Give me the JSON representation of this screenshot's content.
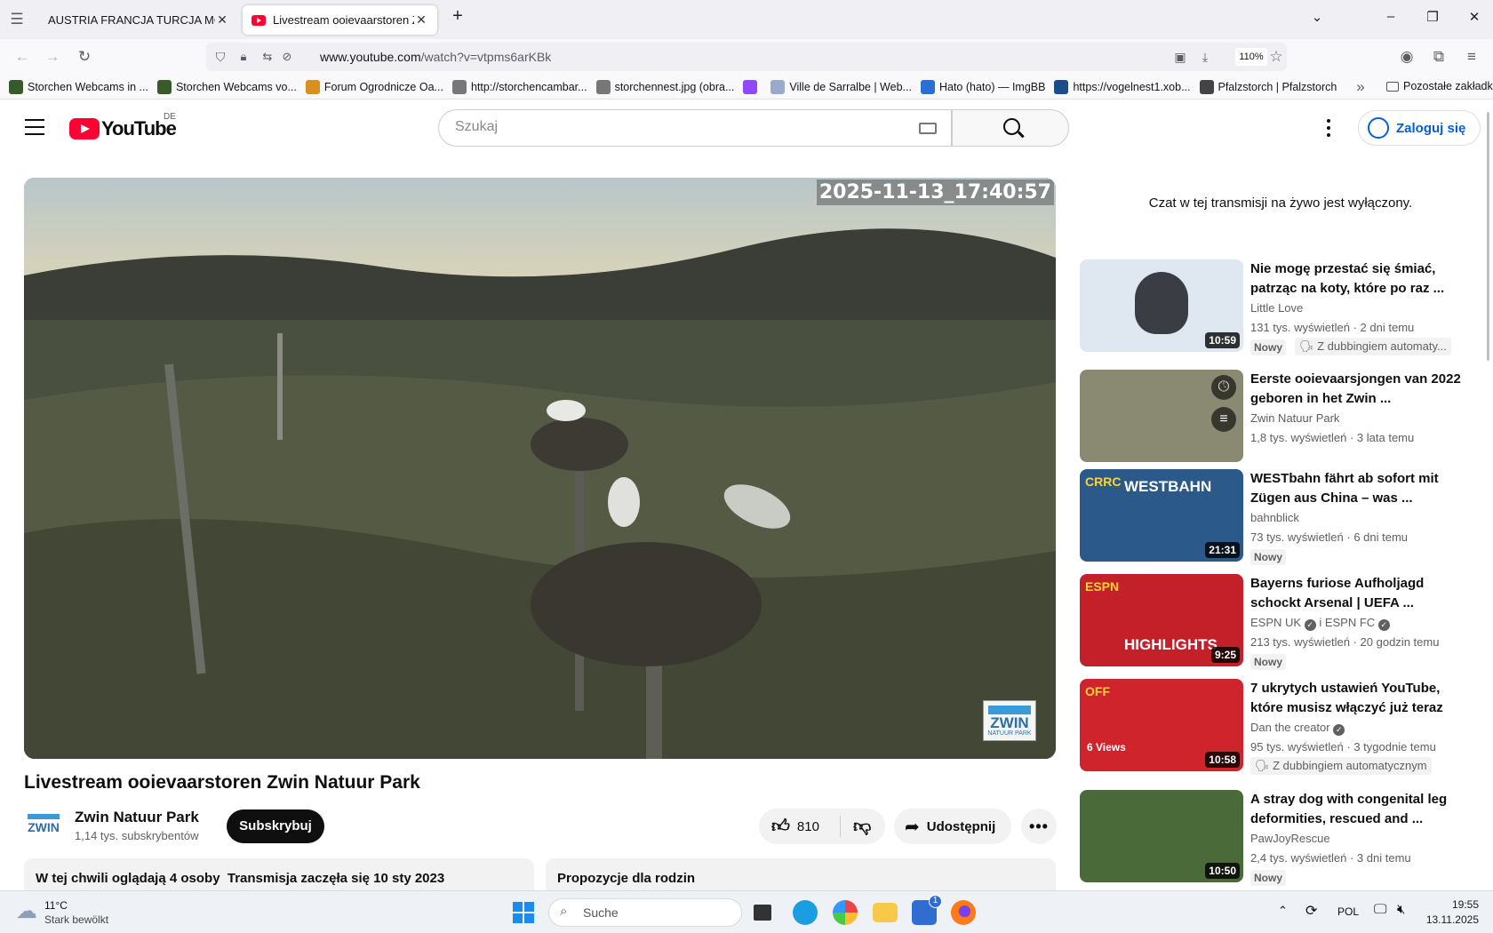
{
  "browser": {
    "tabs": [
      {
        "label": "AUSTRIA FRANCJA TURCJA MONTE",
        "active": false
      },
      {
        "label": "Livestream ooievaarstoren Zwin",
        "active": true
      }
    ],
    "new_tab": "+",
    "url_domain": "www.youtube.com",
    "url_path": "/watch?v=vtpms6arKBk",
    "zoom": "110%",
    "bookmarks": [
      {
        "label": "Storchen Webcams in ...",
        "color": "#3a5a2a"
      },
      {
        "label": "Storchen Webcams vo...",
        "color": "#3a5a2a"
      },
      {
        "label": "Forum Ogrodnicze Oa...",
        "color": "#d89020"
      },
      {
        "label": "http://storchencambar...",
        "color": "#777777"
      },
      {
        "label": "storchennest.jpg (obra...",
        "color": "#777777"
      },
      {
        "label": "",
        "color": "#9146ff"
      },
      {
        "label": "Ville de Sarralbe | Web...",
        "color": "#9aaacc"
      },
      {
        "label": "Hato (hato) — ImgBB",
        "color": "#2a6fd6"
      },
      {
        "label": "https://vogelnest1.xob...",
        "color": "#1a4e8a"
      },
      {
        "label": "Pfalzstorch | Pfalzstorch",
        "color": "#444444"
      }
    ],
    "other_bookmarks": "Pozostałe zakładki"
  },
  "youtube": {
    "logo_text": "YouTube",
    "country_code": "DE",
    "search_placeholder": "Szukaj",
    "signin_label": "Zaloguj się",
    "video": {
      "timestamp_overlay": "2025-11-13_17:40:57",
      "watermark_text": "ZWIN",
      "watermark_sub": "NATUUR PARK",
      "title": "Livestream ooievaarstoren Zwin Natuur Park",
      "channel_name": "Zwin Natuur Park",
      "subscribers": "1,14 tys. subskrybentów",
      "subscribe_label": "Subskrybuj",
      "likes": "810",
      "share_label": "Udostępnij",
      "live_info": "W tej chwili oglądają 4 osoby  Transmisja zaczęła się 10 sty 2023",
      "family_box": "Propozycje dla rodzin"
    },
    "chat_disabled": "Czat w tej transmisji na żywo jest wyłączony.",
    "recommendations": [
      {
        "title": "Nie mogę przestać się śmiać, patrząc na koty, które po raz ...",
        "channel": "Little Love",
        "meta": "131 tys. wyświetleń · 2 dni temu",
        "duration": "10:59",
        "badge": "Nowy",
        "dub": "Z dubbingiem automaty...",
        "thumb_color": "#dfe8f0"
      },
      {
        "title": "Eerste ooievaarsjongen van 2022 geboren in het Zwin ...",
        "channel": "Zwin Natuur Park",
        "meta": "1,8 tys. wyświetleń · 3 lata temu",
        "duration": "",
        "badge": "",
        "dub": "",
        "thumb_color": "#8a8a72"
      },
      {
        "title": "WESTbahn fährt ab sofort mit Zügen aus China – was ...",
        "channel": "bahnblick",
        "meta": "73 tys. wyświetleń · 6 dni temu",
        "duration": "21:31",
        "badge": "Nowy",
        "dub": "",
        "thumb_color": "#2b5a8a",
        "thumb_text": "WESTBAHN",
        "thumb_tag": "CRRC"
      },
      {
        "title": "Bayerns furiose Aufholjagd schockt Arsenal | UEFA ...",
        "channel": "ESPN UK",
        "channel2": "i ESPN FC",
        "meta": "213 tys. wyświetleń · 20 godzin temu",
        "duration": "9:25",
        "badge": "Nowy",
        "dub": "",
        "thumb_color": "#c3202a",
        "thumb_text": "HIGHLIGHTS",
        "thumb_tag": "ESPN"
      },
      {
        "title": "7 ukrytych ustawień YouTube, które musisz włączyć już teraz",
        "channel": "Dan the creator",
        "meta": "95 tys. wyświetleń · 3 tygodnie temu",
        "duration": "10:58",
        "badge": "",
        "dub": "Z dubbingiem automatycznym",
        "thumb_color": "#d0242c",
        "thumb_text": "6 Views",
        "thumb_tag": "OFF"
      },
      {
        "title": "A stray dog with congenital leg deformities, rescued and ...",
        "channel": "PawJoyRescue",
        "meta": "2,4 tys. wyświetleń · 3 dni temu",
        "duration": "10:50",
        "badge": "Nowy",
        "dub": "",
        "thumb_color": "#4a6a3a"
      }
    ]
  },
  "taskbar": {
    "temperature": "11°C",
    "weather": "Stark bewölkt",
    "search_label": "Suche",
    "language": "POL",
    "time": "19:55",
    "date": "13.11.2025",
    "store_badge": "1"
  }
}
